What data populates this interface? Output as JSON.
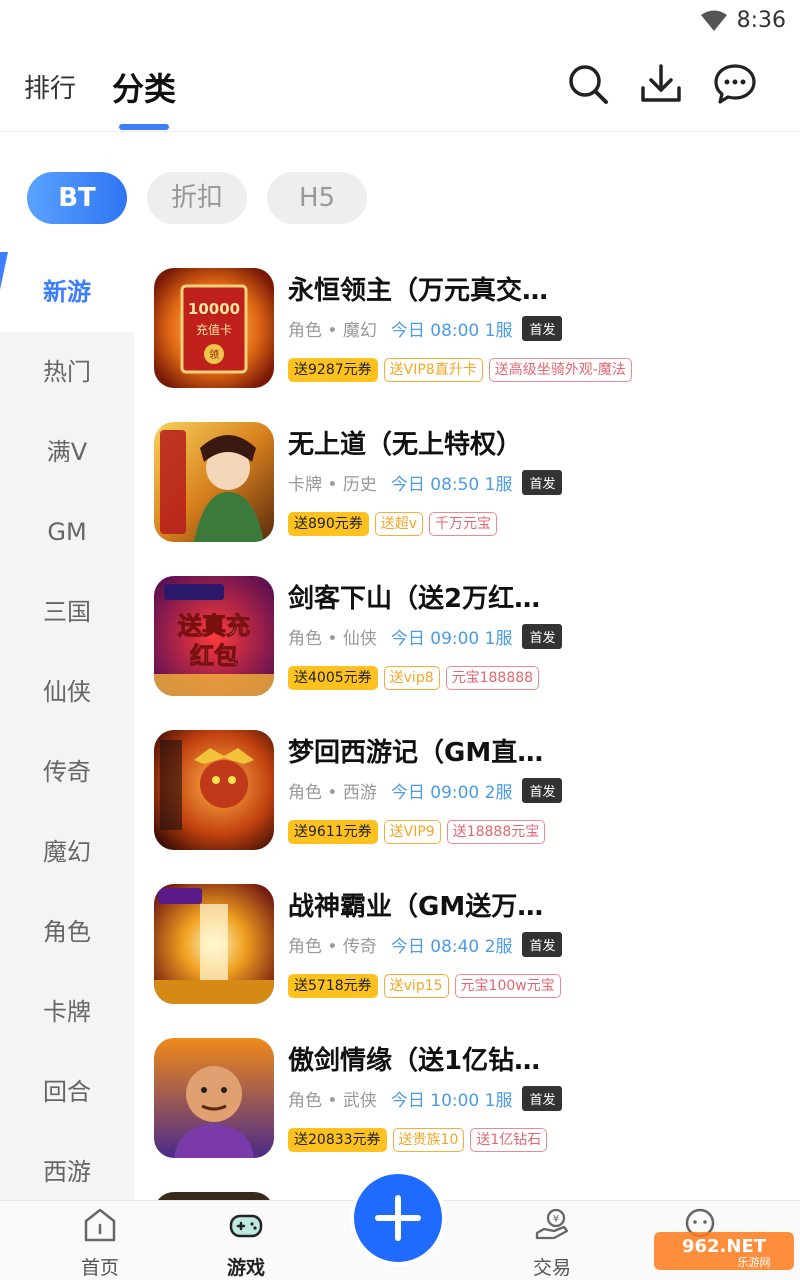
{
  "status_bar": {
    "time": "8:36"
  },
  "top_nav": {
    "tab_rank": "排行",
    "tab_category": "分类"
  },
  "pills": [
    "BT",
    "折扣",
    "H5"
  ],
  "sidebar": [
    "新游",
    "热门",
    "满V",
    "GM",
    "三国",
    "仙侠",
    "传奇",
    "魔幻",
    "角色",
    "卡牌",
    "回合",
    "西游"
  ],
  "games": [
    {
      "title": "永恒领主（万元真交…",
      "genre": "角色 • 魔幻",
      "schedule": "今日 08:00 1服",
      "badge": "首发",
      "tags": [
        "送9287元券",
        "送VIP8直升卡",
        "送高级坐骑外观-魔法"
      ]
    },
    {
      "title": "无上道（无上特权）",
      "genre": "卡牌 • 历史",
      "schedule": "今日 08:50 1服",
      "badge": "首发",
      "tags": [
        "送890元券",
        "送超v",
        "千万元宝"
      ]
    },
    {
      "title": "剑客下山（送2万红…",
      "genre": "角色 • 仙侠",
      "schedule": "今日 09:00 1服",
      "badge": "首发",
      "tags": [
        "送4005元券",
        "送vip8",
        "元宝188888"
      ]
    },
    {
      "title": "梦回西游记（GM直…",
      "genre": "角色 • 西游",
      "schedule": "今日 09:00 2服",
      "badge": "首发",
      "tags": [
        "送9611元券",
        "送VIP9",
        "送18888元宝"
      ]
    },
    {
      "title": "战神霸业（GM送万…",
      "genre": "角色 • 传奇",
      "schedule": "今日 08:40 2服",
      "badge": "首发",
      "tags": [
        "送5718元券",
        "送vip15",
        "元宝100w元宝"
      ]
    },
    {
      "title": "傲剑情缘（送1亿钻…",
      "genre": "角色 • 武侠",
      "schedule": "今日 10:00 1服",
      "badge": "首发",
      "tags": [
        "送20833元券",
        "送贵族10",
        "送1亿钻石"
      ]
    }
  ],
  "thumb_text": {
    "g1_card": "10000",
    "g1_card2": "充值卡",
    "g1_seal": "领",
    "g3_line1": "送真充",
    "g3_line2": "红包"
  },
  "bottom_nav": {
    "home": "首页",
    "games": "游戏",
    "trade": "交易"
  },
  "watermark": {
    "brand": "962.NET",
    "sub": "乐游网"
  },
  "colors": {
    "accent": "#3d7eff",
    "fab": "#1f6bff",
    "tag_gold": "#fdc21f"
  },
  "icons": [
    "wifi-icon",
    "search-icon",
    "download-icon",
    "chat-icon",
    "home-icon",
    "gamepad-icon",
    "plus-icon",
    "trade-icon",
    "profile-icon"
  ]
}
